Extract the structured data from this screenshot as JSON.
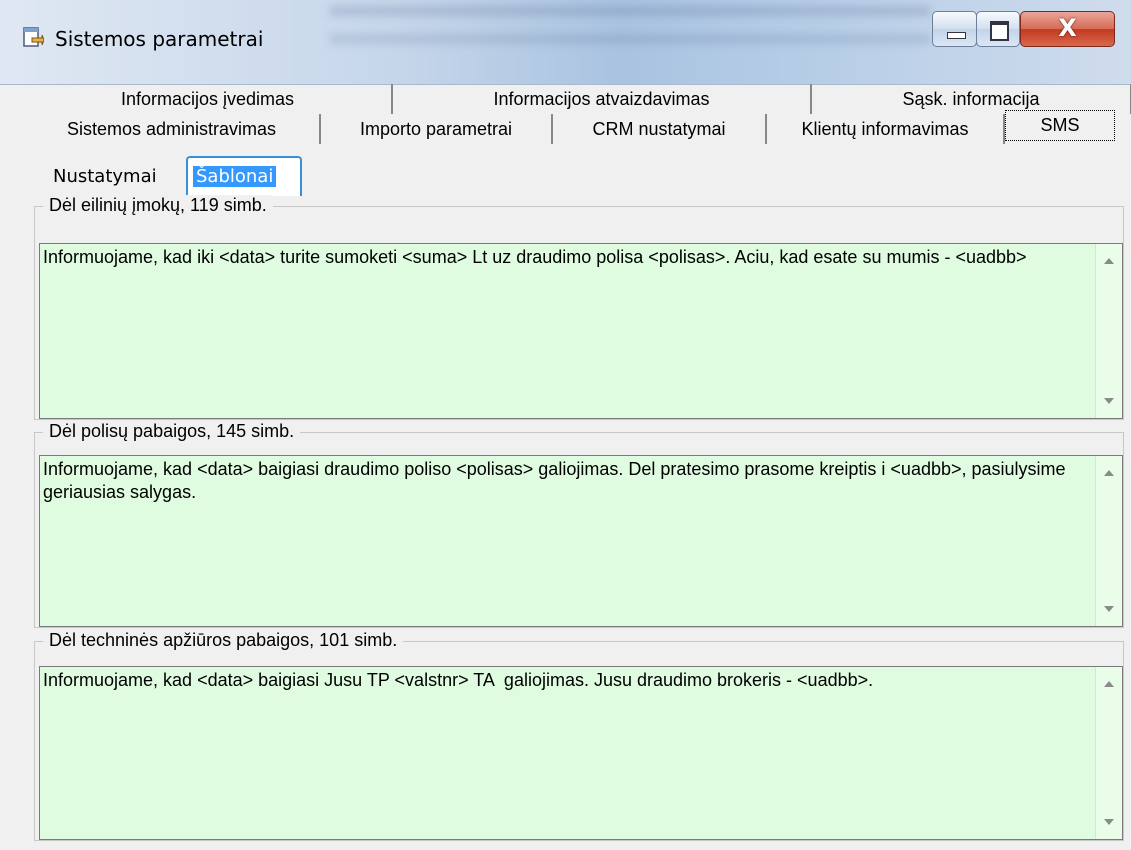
{
  "window": {
    "title": "Sistemos parametrai",
    "close_glyph": "X"
  },
  "tabs_row1": [
    {
      "label": "Informacijos įvedimas"
    },
    {
      "label": "Informacijos atvaizdavimas"
    },
    {
      "label": "Sąsk. informacija"
    }
  ],
  "tabs_row2": [
    {
      "label": "Sistemos administravimas"
    },
    {
      "label": "Importo parametrai"
    },
    {
      "label": "CRM nustatymai"
    },
    {
      "label": "Klientų informavimas"
    },
    {
      "label": "SMS",
      "selected": true
    }
  ],
  "inner_tabs": [
    {
      "label": "Nustatymai"
    },
    {
      "label": "Šablonai",
      "selected": true
    }
  ],
  "templates": [
    {
      "label": "Dėl eilinių įmokų, 119 simb.",
      "text": "Informuojame, kad iki <data> turite sumoketi <suma> Lt uz draudimo polisa <polisas>. Aciu, kad esate su mumis - <uadbb>"
    },
    {
      "label": "Dėl polisų pabaigos, 145 simb.",
      "text": "Informuojame, kad <data> baigiasi draudimo poliso <polisas> galiojimas. Del pratesimo prasome kreiptis i <uadbb>, pasiulysime geriausias salygas."
    },
    {
      "label": "Dėl techninės apžiūros pabaigos, 101 simb.",
      "text": "Informuojame, kad <data> baigiasi Jusu TP <valstnr> TA  galiojimas. Jusu draudimo brokeris - <uadbb>."
    }
  ],
  "colors": {
    "memo_background": "#e0fce0",
    "selected_inner_tab": "#3399ff"
  },
  "icons": {
    "app": "app-window-icon",
    "scroll_up": "scroll-up-arrow-icon",
    "scroll_down": "scroll-down-arrow-icon"
  }
}
